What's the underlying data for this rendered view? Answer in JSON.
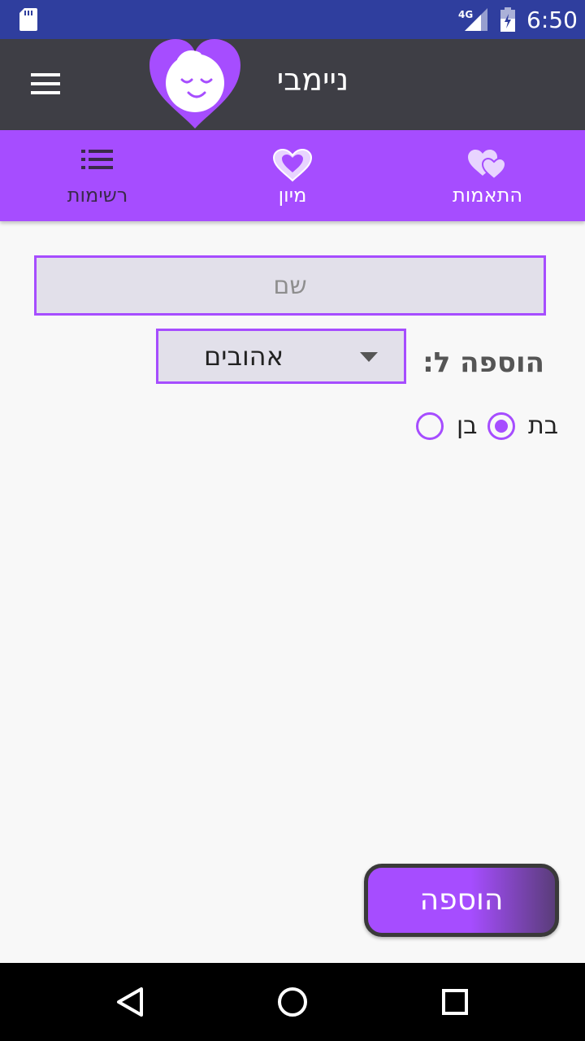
{
  "status_bar": {
    "time": "6:50",
    "network": "4G",
    "icons": [
      "sd-card-icon",
      "signal-icon",
      "battery-charging-icon"
    ]
  },
  "app_bar": {
    "title": "ניימבי",
    "icons": [
      "menu-icon",
      "heart-baby-logo"
    ]
  },
  "tabs": [
    {
      "label": "רשימות",
      "icon": "list-icon",
      "color": "#3a2a4a"
    },
    {
      "label": "מיון",
      "icon": "heart-outline-icon",
      "color": "#ffffff"
    },
    {
      "label": "התאמות",
      "icon": "double-heart-icon",
      "color": "#ffffff"
    }
  ],
  "form": {
    "name_placeholder": "שם",
    "add_to_label": "הוספה ל:",
    "list_select": {
      "selected": "אהובים"
    },
    "gender": {
      "options": [
        {
          "label": "בת",
          "selected": true
        },
        {
          "label": "בן",
          "selected": false
        }
      ]
    },
    "add_button_label": "הוספה"
  },
  "colors": {
    "accent": "#a64dff",
    "status_bar": "#2f3e9e",
    "app_bar": "#3e3e45",
    "background": "#f8f8f8"
  },
  "nav_bar": {
    "icons": [
      "back-icon",
      "home-icon",
      "recents-icon"
    ]
  }
}
